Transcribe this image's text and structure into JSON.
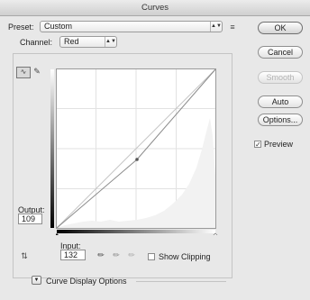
{
  "window": {
    "title": "Curves"
  },
  "preset": {
    "label": "Preset:",
    "value": "Custom"
  },
  "channel": {
    "label": "Channel:",
    "value": "Red"
  },
  "buttons": {
    "ok": "OK",
    "cancel": "Cancel",
    "smooth": "Smooth",
    "auto": "Auto",
    "options": "Options..."
  },
  "preview": {
    "label": "Preview",
    "checked": true
  },
  "output": {
    "label": "Output:",
    "value": "109"
  },
  "input": {
    "label": "Input:",
    "value": "132"
  },
  "show_clipping": {
    "label": "Show Clipping",
    "checked": false
  },
  "curve_display_options": {
    "label": "Curve Display Options"
  },
  "icons": {
    "preset_menu": "preset-options-icon",
    "curve_tool": "curve-points-icon",
    "pencil_tool": "pencil-icon",
    "on_image_adjust": "on-image-adjust-icon",
    "eyedroppers": [
      "black-eyedropper-icon",
      "gray-eyedropper-icon",
      "white-eyedropper-icon"
    ],
    "disclosure": "disclosure-triangle-icon"
  },
  "curve": {
    "channel_color": "#999999",
    "point": {
      "input": 132,
      "output": 109
    }
  }
}
